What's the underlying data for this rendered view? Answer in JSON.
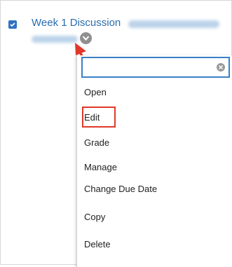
{
  "item": {
    "title": "Week 1 Discussion",
    "checked": true
  },
  "menu": {
    "search_value": "",
    "items": [
      {
        "label": "Open"
      },
      {
        "label": "Edit"
      },
      {
        "label": "Grade"
      },
      {
        "label": "Manage"
      },
      {
        "label": "Change Due Date"
      },
      {
        "label": "Copy"
      },
      {
        "label": "Delete"
      }
    ]
  },
  "colors": {
    "link": "#2a6db0",
    "annotation": "#e0382a",
    "focus": "#3a80c7"
  },
  "icons": {
    "checkbox": "checkbox-checked-icon",
    "menu_toggle": "chevron-down-icon",
    "clear": "close-icon",
    "annotation": "arrow-icon"
  }
}
